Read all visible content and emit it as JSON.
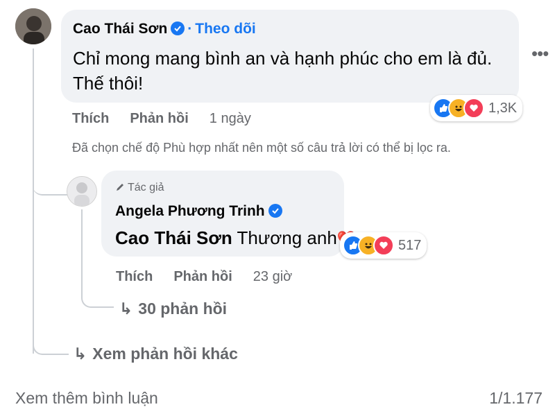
{
  "comment": {
    "author": "Cao Thái Sơn",
    "separator": "·",
    "follow_label": "Theo dõi",
    "text": "Chỉ mong mang bình an và hạnh phúc cho em là đủ. Thế thôi!",
    "reaction_count": "1,3K",
    "like_label": "Thích",
    "reply_label": "Phản hồi",
    "time": "1 ngày",
    "more_icon": "more-horizontal-icon"
  },
  "filter_notice": "Đã chọn chế độ Phù hợp nhất nên một số câu trả lời có thể bị lọc ra.",
  "reply": {
    "badge": "Tác giả",
    "author": "Angela Phương Trinh",
    "mention": "Cao Thái Sơn",
    "text": " Thương anh",
    "heart": "❤️",
    "reaction_count": "517",
    "like_label": "Thích",
    "reply_label": "Phản hồi",
    "time": "23 giờ"
  },
  "replies_link": "30 phản hồi",
  "see_other_replies": "Xem phản hồi khác",
  "see_more_comments": "Xem thêm bình luận",
  "pager": "1/1.177",
  "colors": {
    "accent": "#1877f2",
    "bubble": "#f0f2f5",
    "secondary_text": "#65676b",
    "love": "#f33e58",
    "haha": "#f7b125"
  }
}
